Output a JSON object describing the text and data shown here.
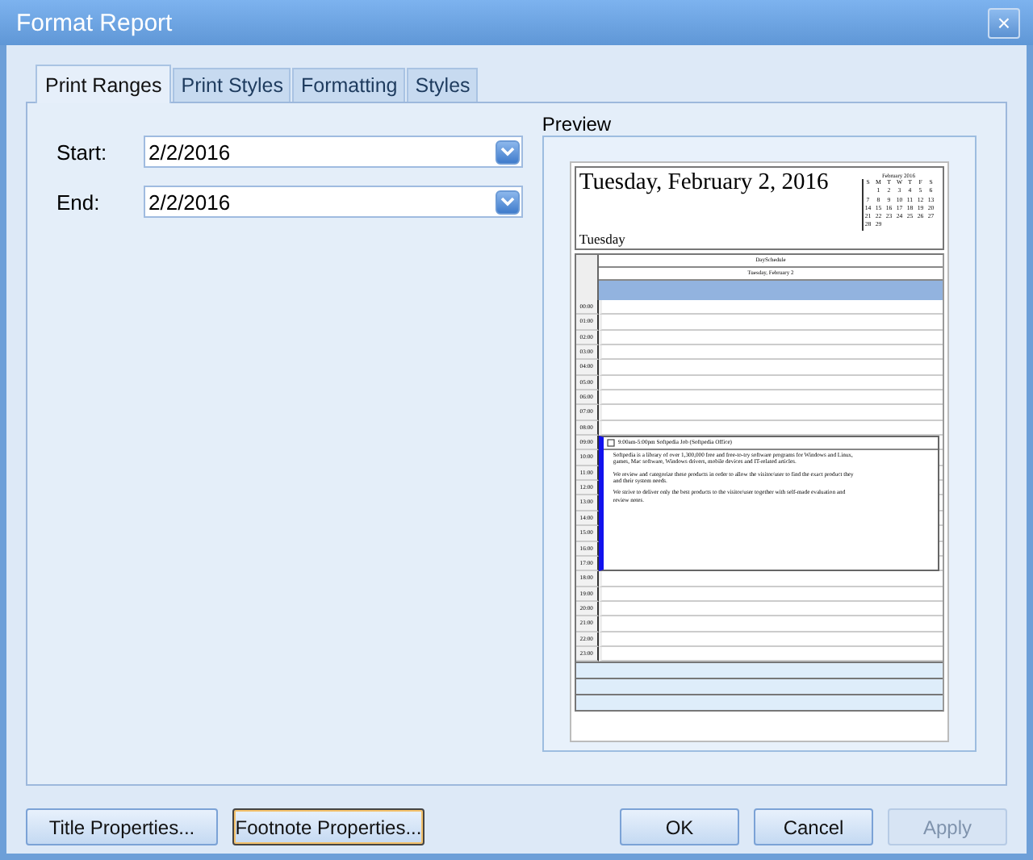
{
  "window": {
    "title": "Format Report",
    "close": "×"
  },
  "tabs": [
    {
      "label": "Print Ranges",
      "selected": true
    },
    {
      "label": "Print Styles",
      "selected": false
    },
    {
      "label": "Formatting",
      "selected": false
    },
    {
      "label": "Styles",
      "selected": false
    }
  ],
  "fields": [
    {
      "label": "Start:",
      "value": "2/2/2016"
    },
    {
      "label": "End:",
      "value": "2/2/2016"
    }
  ],
  "preview": {
    "label": "Preview",
    "date_title": "Tuesday, February 2, 2016",
    "weekday": "Tuesday",
    "calendar": {
      "month": "February 2016",
      "weekdays": [
        "S",
        "M",
        "T",
        "W",
        "T",
        "F",
        "S"
      ],
      "weeks": [
        [
          "1",
          "2",
          "3",
          "4",
          "5",
          "6"
        ],
        [
          "7",
          "8",
          "9",
          "10",
          "11",
          "12",
          "13"
        ],
        [
          "14",
          "15",
          "16",
          "17",
          "18",
          "19",
          "20"
        ],
        [
          "21",
          "22",
          "23",
          "24",
          "25",
          "26",
          "27"
        ],
        [
          "28",
          "29"
        ]
      ]
    },
    "schedule_title": "DaySchedule",
    "day_header": "Tuesday, February 2",
    "hours": [
      "00:00",
      "01:00",
      "02:00",
      "03:00",
      "04:00",
      "05:00",
      "06:00",
      "07:00",
      "08:00",
      "09:00",
      "10:00",
      "11:00",
      "12:00",
      "13:00",
      "14:00",
      "15:00",
      "16:00",
      "17:00",
      "18:00",
      "19:00",
      "20:00",
      "21:00",
      "22:00",
      "23:00"
    ],
    "event": {
      "title": "9:00am-5:00pm Softpedia Job (Softpedia Office)",
      "paragraphs": [
        "Softpedia is a library of over 1,300,000 free and free-to-try software programs for Windows and Linux, games, Mac software, Windows drivers, mobile devices and IT-related articles.",
        "We review and categorize these products in order to allow the visitor/user to find the exact product they and their system needs.",
        "We strive to deliver only the best products to the visitor/user together with self-made evaluation and review notes."
      ]
    }
  },
  "left_buttons": [
    {
      "label": "Title Properties...",
      "focused": false,
      "disabled": false
    },
    {
      "label": "Footnote Properties...",
      "focused": true,
      "disabled": false
    }
  ],
  "buttons": [
    {
      "label": "OK",
      "focused": false,
      "disabled": false
    },
    {
      "label": "Cancel",
      "focused": false,
      "disabled": false
    },
    {
      "label": "Apply",
      "focused": false,
      "disabled": true
    }
  ]
}
